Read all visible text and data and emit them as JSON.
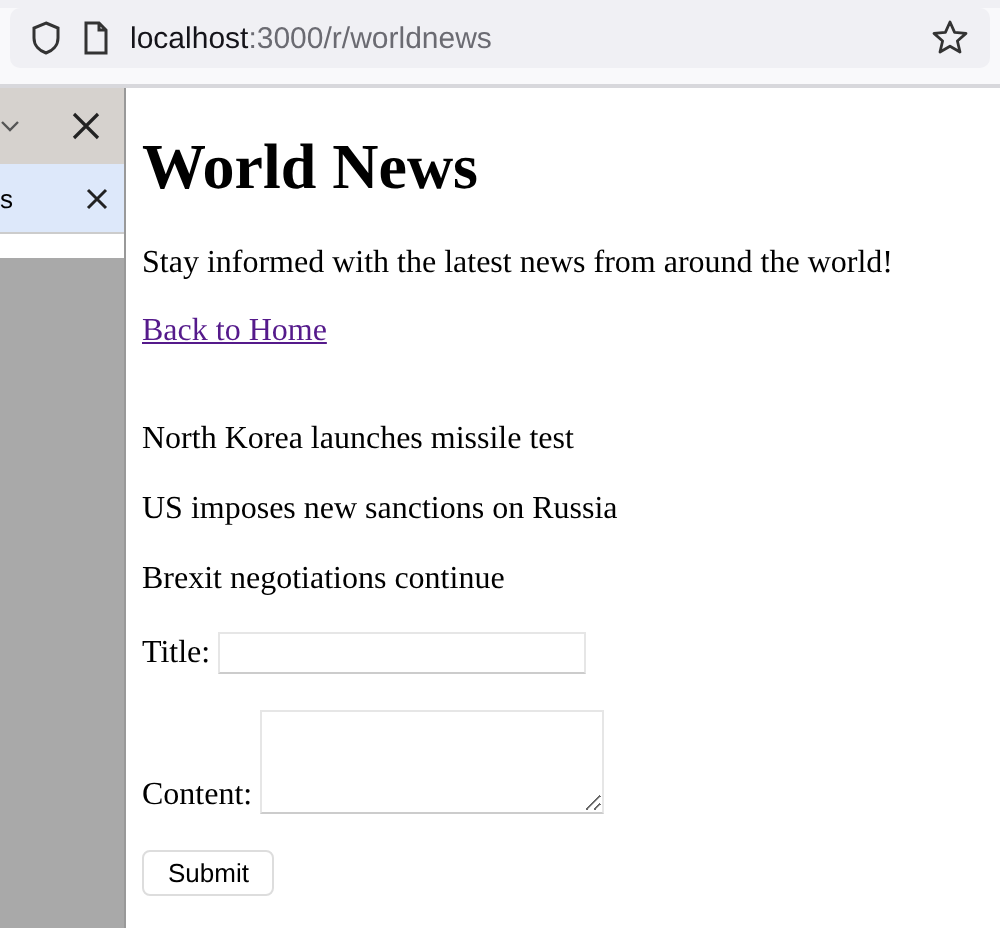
{
  "browser": {
    "url_host": "localhost",
    "url_path": ":3000/r/worldnews"
  },
  "side_panel": {
    "tab_label": "s"
  },
  "page": {
    "title": "World News",
    "intro": "Stay informed with the latest news from around the world!",
    "back_link": "Back to Home",
    "posts": [
      "North Korea launches missile test",
      "US imposes new sanctions on Russia",
      "Brexit negotiations continue"
    ],
    "form": {
      "title_label": "Title:",
      "content_label": "Content:",
      "submit": "Submit"
    }
  }
}
